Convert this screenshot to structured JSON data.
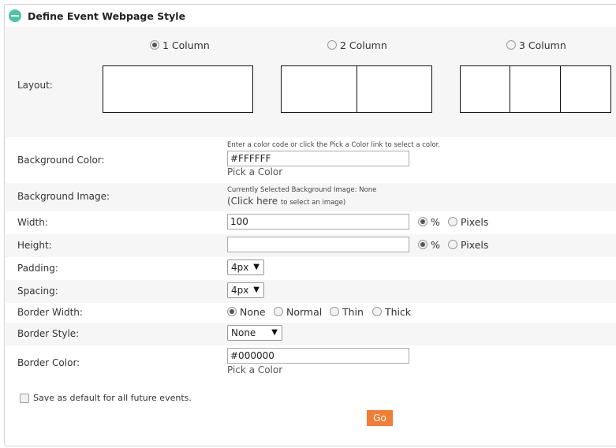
{
  "panel": {
    "title": "Define Event Webpage Style",
    "collapse_icon": "minus-circle-icon",
    "accent_color": "#4cc3a5"
  },
  "layout": {
    "label": "Layout:",
    "options": [
      {
        "label": "1 Column",
        "selected": true
      },
      {
        "label": "2 Column",
        "selected": false
      },
      {
        "label": "3 Column",
        "selected": false
      }
    ]
  },
  "background_color": {
    "label": "Background Color:",
    "hint": "Enter a color code or click the Pick a Color link to select a color.",
    "value": "#FFFFFF",
    "pick_label": "Pick a Color"
  },
  "background_image": {
    "label": "Background Image:",
    "current": "Currently Selected Background Image: None",
    "click_here": "(Click here",
    "click_suffix": "to select an image)"
  },
  "width": {
    "label": "Width:",
    "value": "100",
    "unit_percent": "%",
    "unit_pixels": "Pixels",
    "selected_unit": "percent"
  },
  "height": {
    "label": "Height:",
    "value": "",
    "unit_percent": "%",
    "unit_pixels": "Pixels",
    "selected_unit": "percent"
  },
  "padding": {
    "label": "Padding:",
    "value": "4px"
  },
  "spacing": {
    "label": "Spacing:",
    "value": "4px"
  },
  "border_width": {
    "label": "Border Width:",
    "options": [
      {
        "label": "None",
        "selected": true
      },
      {
        "label": "Normal",
        "selected": false
      },
      {
        "label": "Thin",
        "selected": false
      },
      {
        "label": "Thick",
        "selected": false
      }
    ]
  },
  "border_style": {
    "label": "Border Style:",
    "value": "None"
  },
  "border_color": {
    "label": "Border Color:",
    "value": "#000000",
    "pick_label": "Pick a Color"
  },
  "save_default": {
    "label": "Save as default for all future events.",
    "checked": false
  },
  "go_button": {
    "label": "Go",
    "color": "#f27d35"
  }
}
